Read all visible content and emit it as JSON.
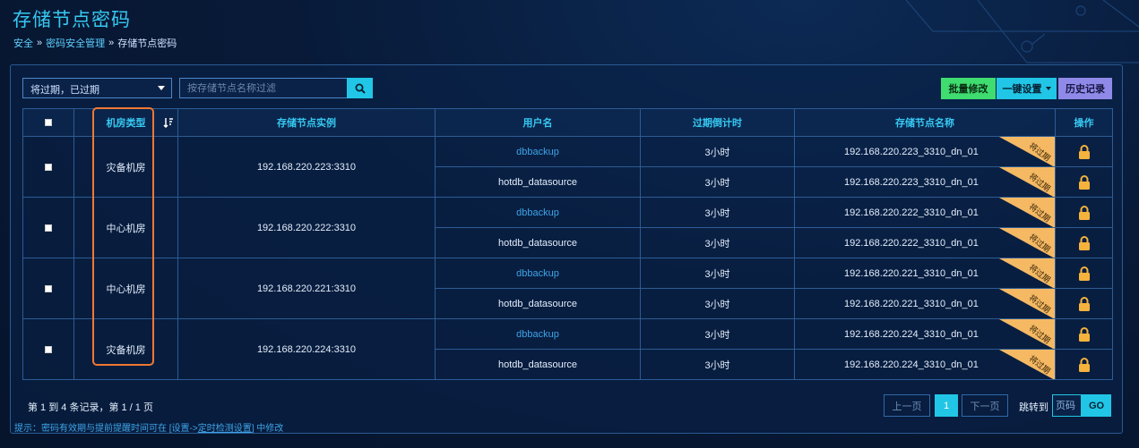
{
  "page": {
    "title": "存储节点密码"
  },
  "breadcrumb": {
    "item1": "安全",
    "item2": "密码安全管理",
    "item3": "存储节点密码",
    "sep": "»"
  },
  "toolbar": {
    "filter_value": "将过期，已过期",
    "search_placeholder": "按存储节点名称过滤",
    "batch_label": "批量修改",
    "onekey_label": "一键设置",
    "history_label": "历史记录"
  },
  "table": {
    "headers": {
      "room_type": "机房类型",
      "instance": "存储节点实例",
      "username": "用户名",
      "countdown": "过期倒计时",
      "node_name": "存储节点名称",
      "action": "操作"
    },
    "ribbon_label": "将过期",
    "groups": [
      {
        "room": "灾备机房",
        "instance": "192.168.220.223:3310",
        "rows": [
          {
            "user": "dbbackup",
            "countdown": "3小时",
            "node": "192.168.220.223_3310_dn_01"
          },
          {
            "user": "hotdb_datasource",
            "countdown": "3小时",
            "node": "192.168.220.223_3310_dn_01"
          }
        ]
      },
      {
        "room": "中心机房",
        "instance": "192.168.220.222:3310",
        "rows": [
          {
            "user": "dbbackup",
            "countdown": "3小时",
            "node": "192.168.220.222_3310_dn_01"
          },
          {
            "user": "hotdb_datasource",
            "countdown": "3小时",
            "node": "192.168.220.222_3310_dn_01"
          }
        ]
      },
      {
        "room": "中心机房",
        "instance": "192.168.220.221:3310",
        "rows": [
          {
            "user": "dbbackup",
            "countdown": "3小时",
            "node": "192.168.220.221_3310_dn_01"
          },
          {
            "user": "hotdb_datasource",
            "countdown": "3小时",
            "node": "192.168.220.221_3310_dn_01"
          }
        ]
      },
      {
        "room": "灾备机房",
        "instance": "192.168.220.224:3310",
        "rows": [
          {
            "user": "dbbackup",
            "countdown": "3小时",
            "node": "192.168.220.224_3310_dn_01"
          },
          {
            "user": "hotdb_datasource",
            "countdown": "3小时",
            "node": "192.168.220.224_3310_dn_01"
          }
        ]
      }
    ]
  },
  "footer": {
    "summary": "第 1 到 4 条记录，第 1 / 1 页",
    "tip_prefix": "提示：密码有效期与提前提醒时间可在 [设置->",
    "tip_link": "定时检测设置",
    "tip_suffix": "] 中修改"
  },
  "pagination": {
    "prev": "上一页",
    "current": "1",
    "next": "下一页",
    "jump_label": "跳转到",
    "page_placeholder": "页码",
    "go": "GO"
  },
  "colors": {
    "accent": "#21c6e6",
    "batch": "#3fdc6f",
    "history": "#8f89e8",
    "ribbon": "#f5b964",
    "highlight": "#f07833",
    "lock": "#f5b23c"
  }
}
